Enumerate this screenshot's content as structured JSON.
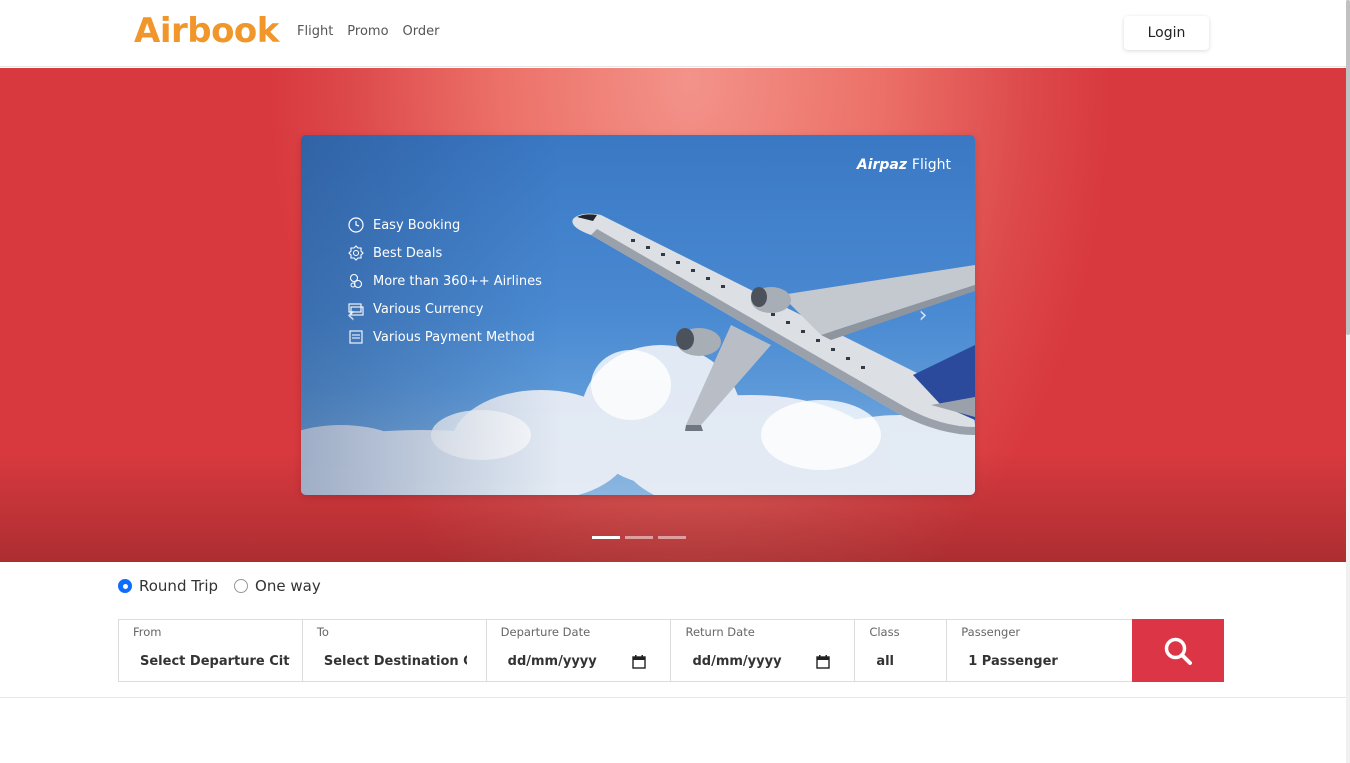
{
  "navbar": {
    "brand": "Airbook",
    "links": [
      "Flight",
      "Promo",
      "Order"
    ],
    "login_label": "Login"
  },
  "hero": {
    "slide": {
      "logo_brand": "Airpaz",
      "logo_suffix": "Flight",
      "features": [
        {
          "icon": "clock-icon",
          "label": "Easy Booking"
        },
        {
          "icon": "badge-icon",
          "label": "Best Deals"
        },
        {
          "icon": "airlines-icon",
          "label": "More than 360++ Airlines"
        },
        {
          "icon": "currency-icon",
          "label": "Various Currency"
        },
        {
          "icon": "payment-icon",
          "label": "Various Payment Method"
        }
      ]
    },
    "carousel": {
      "prev_icon": "chevron-left-icon",
      "next_icon": "chevron-right-icon",
      "slide_count": 3,
      "active_index": 0
    }
  },
  "trip_type": {
    "options": [
      "Round Trip",
      "One way"
    ],
    "selected": "Round Trip"
  },
  "search": {
    "from": {
      "label": "From",
      "value": "Select Departure City"
    },
    "to": {
      "label": "To",
      "value": "Select Destination City"
    },
    "departure": {
      "label": "Departure Date",
      "value": "dd/mm/yyyy"
    },
    "return": {
      "label": "Return Date",
      "value": "dd/mm/yyyy"
    },
    "class": {
      "label": "Class",
      "value": "all"
    },
    "passenger": {
      "label": "Passenger",
      "value": "1 Passenger"
    },
    "button_icon": "search-icon"
  },
  "colors": {
    "brand": "#f0962a",
    "hero": "#dd4a4c",
    "search_button": "#dc3545",
    "radio_checked": "#0d6efd"
  }
}
